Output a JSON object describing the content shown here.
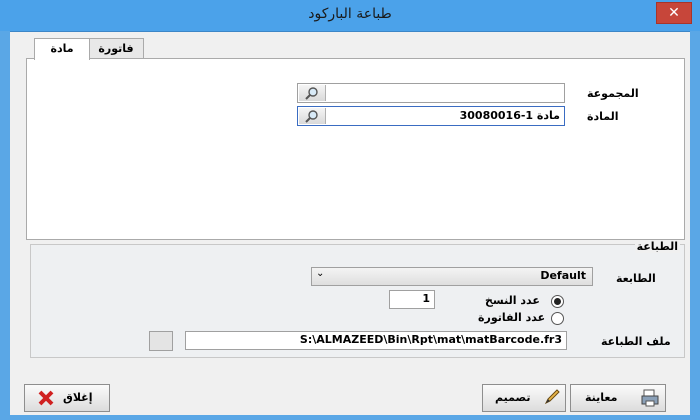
{
  "window": {
    "title": "طباعة الباركود",
    "close_label": "✕"
  },
  "tabs": [
    {
      "label": "مادة",
      "active": true
    },
    {
      "label": "فاتورة",
      "active": false
    }
  ],
  "fields": {
    "group_label": "المجموعة",
    "group_value": "",
    "item_label": "المادة",
    "item_value": "30080016-مادة 1"
  },
  "printing": {
    "section_title": "الطباعة",
    "printer_label": "الطابعة",
    "printer_value": "Default",
    "copies_option": "عدد النسخ",
    "copies_value": "1",
    "invoice_option": "عدد الفاتورة",
    "print_file_label": "ملف الطباعة",
    "print_file_value": "S:\\ALMAZEED\\Bin\\Rpt\\mat\\matBarcode.fr3"
  },
  "buttons": {
    "close": "إغلاق",
    "design": "تصميم",
    "preview": "معاينة"
  },
  "colors": {
    "titlebar": "#4ba2ea",
    "close": "#c7463a"
  }
}
